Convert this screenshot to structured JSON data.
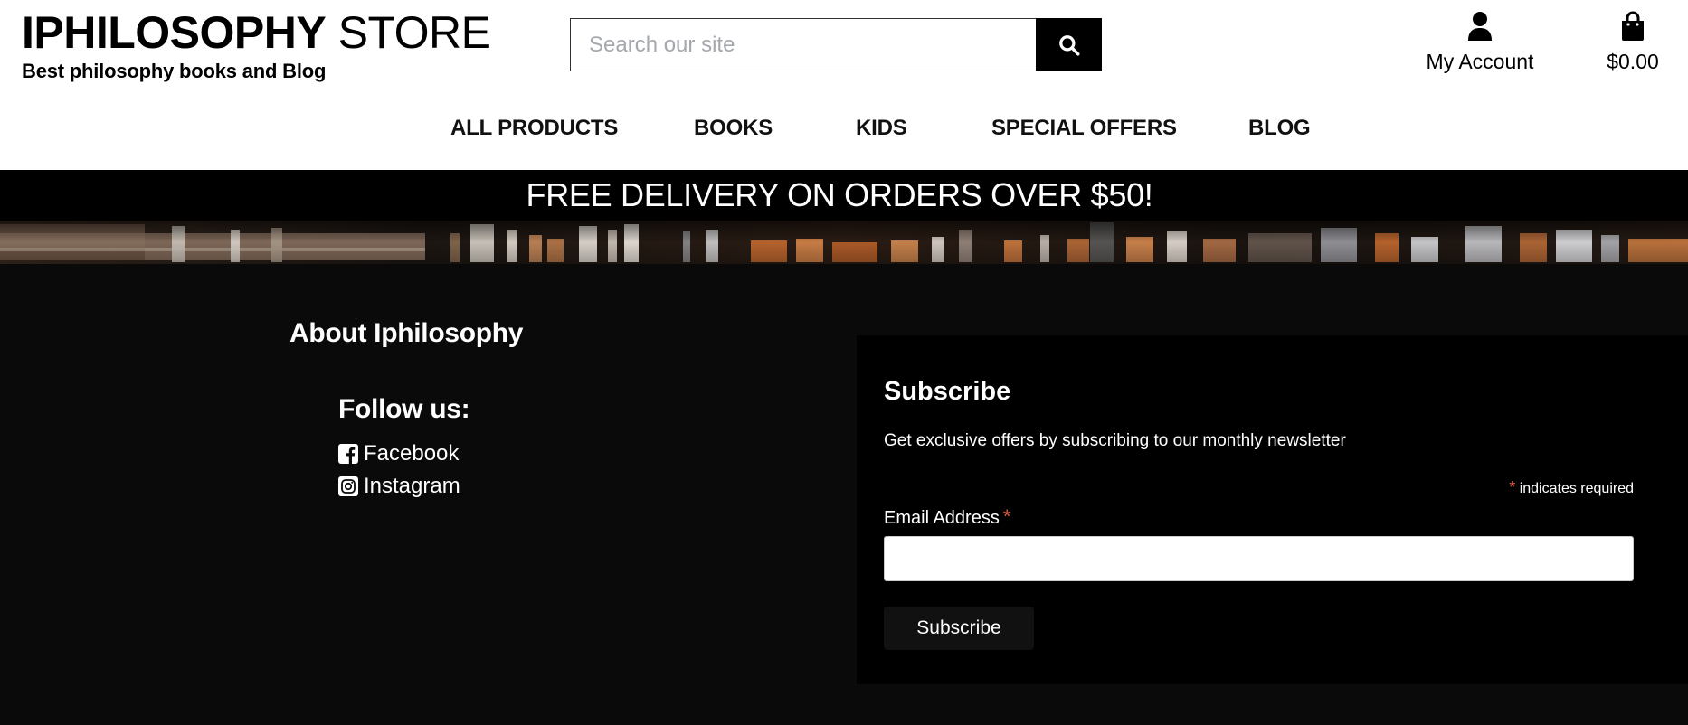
{
  "header": {
    "brand_bold": "IPHILOSOPHY",
    "brand_light": "STORE",
    "tagline": "Best philosophy books and Blog",
    "search": {
      "placeholder": "Search our site",
      "button_icon": "search-icon"
    },
    "account": {
      "label": "My Account",
      "icon": "user-icon"
    },
    "cart": {
      "total": "$0.00",
      "icon": "shopping-bag-icon"
    }
  },
  "nav": {
    "items": [
      {
        "label": "ALL PRODUCTS"
      },
      {
        "label": "BOOKS"
      },
      {
        "label": "KIDS"
      },
      {
        "label": "SPECIAL OFFERS"
      },
      {
        "label": "BLOG"
      }
    ]
  },
  "banner": {
    "text": "FREE DELIVERY ON ORDERS OVER $50!"
  },
  "footer": {
    "about_title": "About Iphilosophy",
    "follow_title": "Follow us:",
    "social": [
      {
        "label": "Facebook",
        "icon": "facebook-square-icon"
      },
      {
        "label": "Instagram",
        "icon": "instagram-icon"
      }
    ],
    "subscribe": {
      "title": "Subscribe",
      "description": "Get exclusive offers by subscribing to our monthly newsletter",
      "required_star": "*",
      "required_note": "indicates required",
      "email_label": "Email Address",
      "email_value": "",
      "button": "Subscribe"
    }
  },
  "colors": {
    "header_bg": "#ffffff",
    "banner_bg": "#000000",
    "footer_bg": "#0a0a0a",
    "required_star": "#e85c41"
  }
}
